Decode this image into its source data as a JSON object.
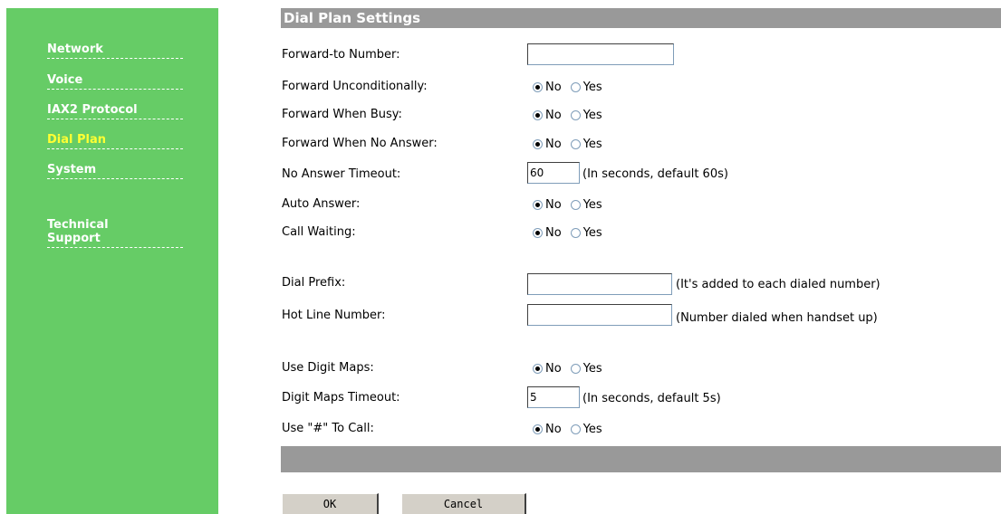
{
  "sidebar": {
    "items": [
      {
        "label": "Network",
        "active": false
      },
      {
        "label": "Voice",
        "active": false
      },
      {
        "label": "IAX2 Protocol",
        "active": false
      },
      {
        "label": "Dial Plan",
        "active": true
      },
      {
        "label": "System",
        "active": false
      }
    ],
    "support_label_line1": "Technical",
    "support_label_line2": "Support"
  },
  "header": {
    "title": "Dial Plan Settings"
  },
  "options": {
    "no": "No",
    "yes": "Yes"
  },
  "form": {
    "forward_to_number": {
      "label": "Forward-to Number:",
      "value": ""
    },
    "forward_unconditionally": {
      "label": "Forward Unconditionally:",
      "selected": "No"
    },
    "forward_when_busy": {
      "label": "Forward When Busy:",
      "selected": "No"
    },
    "forward_when_no_answer": {
      "label": "Forward When No Answer:",
      "selected": "No"
    },
    "no_answer_timeout": {
      "label": "No Answer Timeout:",
      "value": "60",
      "hint": "(In seconds, default 60s)"
    },
    "auto_answer": {
      "label": "Auto Answer:",
      "selected": "No"
    },
    "call_waiting": {
      "label": "Call Waiting:",
      "selected": "No"
    },
    "dial_prefix": {
      "label": "Dial Prefix:",
      "value": "",
      "hint": "(It's added to each dialed number)"
    },
    "hot_line_number": {
      "label": "Hot Line Number:",
      "value": "",
      "hint": "(Number dialed when handset up)"
    },
    "use_digit_maps": {
      "label": "Use Digit Maps:",
      "selected": "No"
    },
    "digit_maps_timeout": {
      "label": "Digit Maps Timeout:",
      "value": "5",
      "hint": "(In seconds, default 5s)"
    },
    "use_hash_to_call": {
      "label": "Use \"#\" To Call:",
      "selected": "No"
    }
  },
  "buttons": {
    "ok": "OK",
    "cancel": "Cancel"
  },
  "colors": {
    "sidebar": "#66cc66",
    "header": "#999999",
    "active_nav": "#ffff33"
  }
}
